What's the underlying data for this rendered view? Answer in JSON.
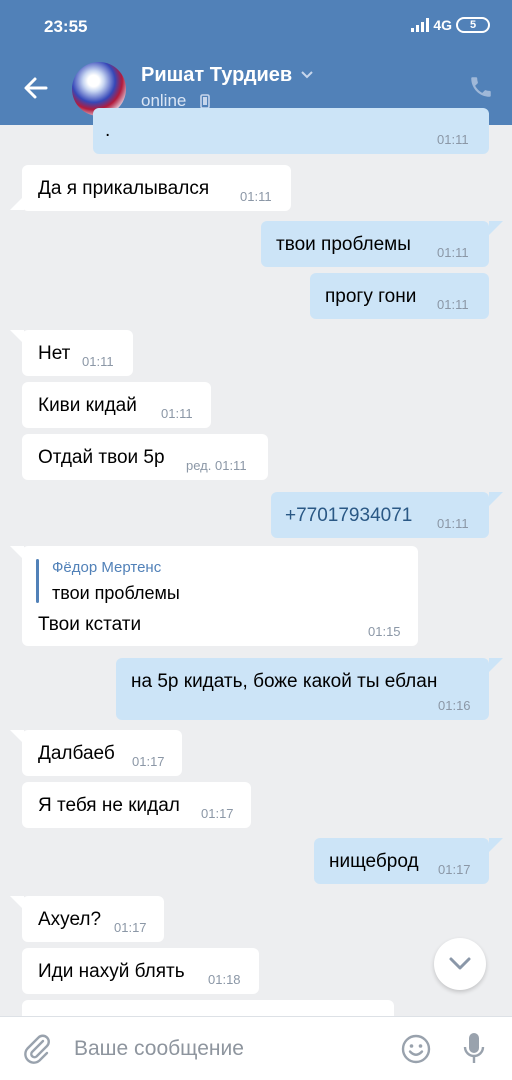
{
  "status_bar": {
    "time": "23:55",
    "network": "4G",
    "battery": "5",
    "icons": [
      "signal-icon",
      "battery-icon"
    ]
  },
  "header": {
    "contact_name": "Ришат Турдиев",
    "contact_status": "online",
    "icons": [
      "back-arrow-icon",
      "chevron-down-icon",
      "mobile-phone-icon",
      "call-icon"
    ]
  },
  "messages": [
    {
      "dir": "out",
      "text": ".",
      "time": "01:11"
    },
    {
      "dir": "in",
      "text": "Да я прикалывался",
      "time": "01:11"
    },
    {
      "dir": "out",
      "text": "твои проблемы",
      "time": "01:11"
    },
    {
      "dir": "out",
      "text": "прогу гони",
      "time": "01:11"
    },
    {
      "dir": "in",
      "text": "Нет",
      "time": "01:11"
    },
    {
      "dir": "in",
      "text": "Киви кидай",
      "time": "01:11"
    },
    {
      "dir": "in",
      "text": "Отдай твои 5р",
      "time": "ред. 01:11"
    },
    {
      "dir": "out",
      "text": "+77017934071",
      "time": "01:11"
    },
    {
      "dir": "in",
      "reply_author": "Фёдор Мертенс",
      "reply_text": "твои проблемы",
      "text": "Твои кстати",
      "time": "01:15"
    },
    {
      "dir": "out",
      "text": "на 5р кидать, боже какой ты еблан",
      "time": "01:16"
    },
    {
      "dir": "in",
      "text": "Далбаеб",
      "time": "01:17"
    },
    {
      "dir": "in",
      "text": "Я тебя не кидал",
      "time": "01:17"
    },
    {
      "dir": "out",
      "text": "нищеброд",
      "time": "01:17"
    },
    {
      "dir": "in",
      "text": "Ахуел?",
      "time": "01:17"
    },
    {
      "dir": "in",
      "text": "Иди нахуй блять",
      "time": "01:18"
    }
  ],
  "composer": {
    "placeholder": "Ваше сообщение",
    "icons": [
      "paperclip-icon",
      "emoji-icon",
      "microphone-icon",
      "scroll-down-icon"
    ]
  },
  "colors": {
    "header": "#5181b8",
    "background": "#edeef0",
    "incoming_bubble": "#ffffff",
    "outgoing_bubble": "#cce4f7",
    "link": "#2a5885"
  }
}
